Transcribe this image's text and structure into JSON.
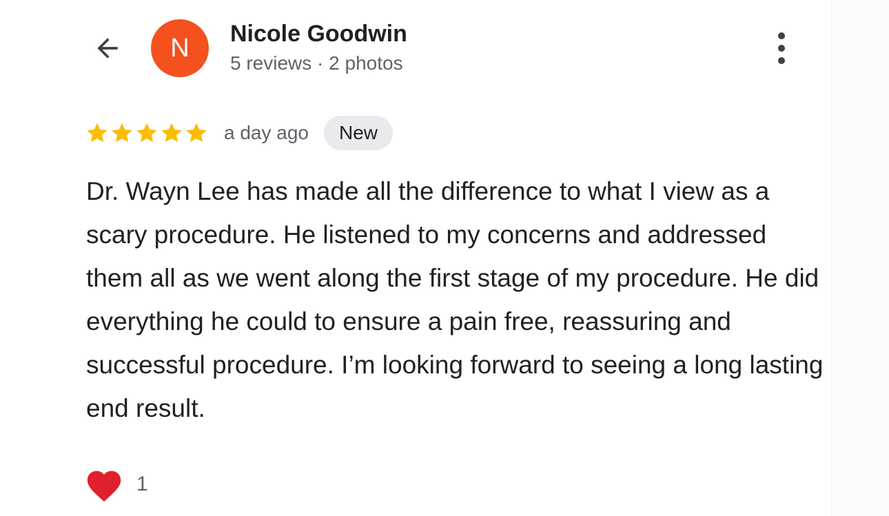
{
  "user": {
    "initial": "N",
    "name": "Nicole Goodwin",
    "meta": "5 reviews · 2 photos"
  },
  "review": {
    "rating": 5,
    "time_ago": "a day ago",
    "badge": "New",
    "text": "Dr. Wayn Lee has made all the difference to what I view as a scary procedure. He listened to my concerns and addressed them all as we went along the first stage of my procedure. He did everything he could to ensure a pain free, reassuring and successful procedure. I’m looking forward to seeing a long lasting end result.",
    "reaction_count": "1"
  },
  "icons": {
    "back": "arrow-left-icon",
    "more": "more-vertical-icon",
    "star": "star-icon",
    "reaction": "heart-icon"
  },
  "colors": {
    "avatar_bg": "#f4511e",
    "star": "#fbbc04",
    "heart": "#e0202c"
  }
}
